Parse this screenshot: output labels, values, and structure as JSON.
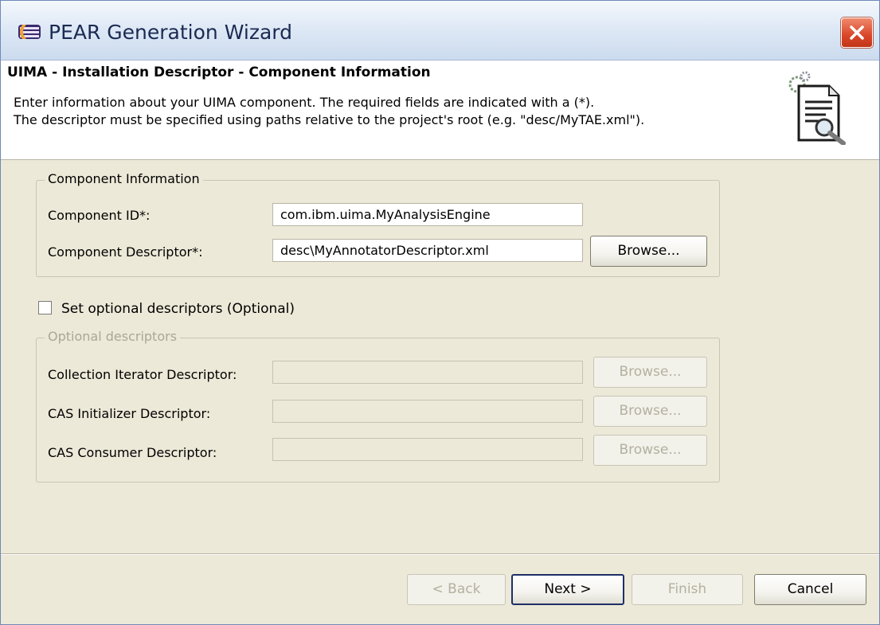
{
  "window": {
    "title": "PEAR Generation Wizard",
    "icons": {
      "app": "eclipse-logo-icon",
      "close": "close-icon"
    }
  },
  "header": {
    "title": "UIMA - Installation Descriptor - Component Information",
    "description_line1": "Enter information about your UIMA component. The required fields are indicated with a (*).",
    "description_line2": "The descriptor must be specified using paths relative to the project's root (e.g. \"desc/MyTAE.xml\").",
    "icon": "document-gears-icon"
  },
  "component_info": {
    "legend": "Component Information",
    "id_label": "Component ID*:",
    "id_value": "com.ibm.uima.MyAnalysisEngine",
    "descriptor_label": "Component Descriptor*:",
    "descriptor_value": "desc\\MyAnnotatorDescriptor.xml",
    "browse_label": "Browse..."
  },
  "optional": {
    "checkbox_label": "Set optional descriptors (Optional)",
    "checked": false,
    "legend": "Optional descriptors",
    "rows": [
      {
        "label": "Collection Iterator Descriptor:",
        "value": "",
        "browse": "Browse..."
      },
      {
        "label": "CAS Initializer Descriptor:",
        "value": "",
        "browse": "Browse..."
      },
      {
        "label": "CAS Consumer Descriptor:",
        "value": "",
        "browse": "Browse..."
      }
    ]
  },
  "footer": {
    "back": "< Back",
    "next": "Next >",
    "finish": "Finish",
    "cancel": "Cancel"
  }
}
